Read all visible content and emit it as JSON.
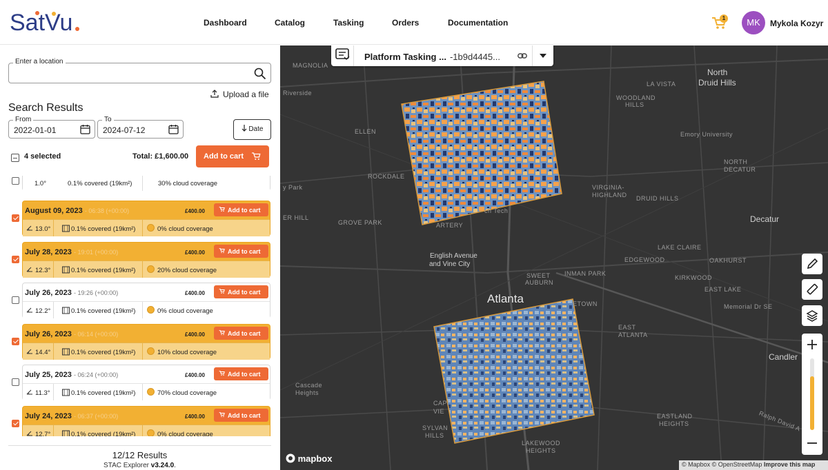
{
  "brand": {
    "name": "SatVu"
  },
  "nav": {
    "items": [
      "Dashboard",
      "Catalog",
      "Tasking",
      "Orders",
      "Documentation"
    ]
  },
  "cart": {
    "count": "1"
  },
  "user": {
    "initials": "MK",
    "name": "Mykola Kozyr"
  },
  "search": {
    "label": "Enter a location",
    "value": "",
    "upload_label": "Upload a file"
  },
  "results": {
    "title": "Search Results",
    "from_label": "From",
    "from_value": "2022-01-01",
    "to_label": "To",
    "to_value": "2024-07-12",
    "sort_label": "Date",
    "selected_text": "4 selected",
    "total_text": "Total: £1,600.00",
    "add_all_label": "Add to cart",
    "count_text": "12/12 Results",
    "explorer_prefix": "STAC Explorer ",
    "explorer_version": "v3.24.0",
    "explorer_suffix": ".",
    "partial_row": {
      "angle": "1.0°",
      "covered": "0.1% covered (19km²)",
      "cloud": "30% cloud coverage"
    },
    "items": [
      {
        "date": "August 09, 2023",
        "time": "- 06:38 (+00:00)",
        "price": "£400.00",
        "add": "Add to cart",
        "angle": "13.0°",
        "covered": "0.1% covered (19km²)",
        "cloud": "0% cloud coverage",
        "selected": true
      },
      {
        "date": "July 28, 2023",
        "time": "- 19:01 (+00:00)",
        "price": "£400.00",
        "add": "Add to cart",
        "angle": "12.3°",
        "covered": "0.1% covered (19km²)",
        "cloud": "20% cloud coverage",
        "selected": true
      },
      {
        "date": "July 26, 2023",
        "time": "- 19:26 (+00:00)",
        "price": "£400.00",
        "add": "Add to cart",
        "angle": "12.2°",
        "covered": "0.1% covered (19km²)",
        "cloud": "0% cloud coverage",
        "selected": false
      },
      {
        "date": "July 26, 2023",
        "time": "- 06:14 (+00:00)",
        "price": "£400.00",
        "add": "Add to cart",
        "angle": "14.4°",
        "covered": "0.1% covered (19km²)",
        "cloud": "10% cloud coverage",
        "selected": true
      },
      {
        "date": "July 25, 2023",
        "time": "- 06:24 (+00:00)",
        "price": "£400.00",
        "add": "Add to cart",
        "angle": "11.3°",
        "covered": "0.1% covered (19km²)",
        "cloud": "70% cloud coverage",
        "selected": false
      },
      {
        "date": "July 24, 2023",
        "time": "- 06:37 (+00:00)",
        "price": "£400.00",
        "add": "Add to cart",
        "angle": "12.7°",
        "covered": "0.1% covered (19km²)",
        "cloud": "0% cloud coverage",
        "selected": true
      }
    ]
  },
  "map": {
    "tab_title": "Platform Tasking ...",
    "tab_id": "-1b9d4445...",
    "logo": "mapbox",
    "attribution": "© Mapbox © OpenStreetMap ",
    "improve": "Improve this map",
    "zoom_level": 0.75,
    "labels": [
      "MAGNOLIA",
      "North",
      "Druid Hills",
      "LA VISTA",
      "Riverside",
      "WOODLAND",
      "HILLS",
      "ELLEN",
      "Emory University",
      "NORTH",
      "DECATUR",
      "ROCKDALE",
      "y Park",
      "VIRGINIA-",
      "HIGHLAND",
      "DRUID HILLS",
      "ER HILL",
      "GROVE PARK",
      "ARTERY",
      "ch Tech",
      "Decatur",
      "LAKE CLAIRE",
      "English Avenue",
      "and Vine City",
      "EDGEWOOD",
      "OAKHURST",
      "SWEET",
      "AUBURN",
      "INMAN PARK",
      "KIRKWOOD",
      "Atlanta",
      "ETOWN",
      "EAST LAKE",
      "Memorial Dr SE",
      "EAST",
      "ATLANTA",
      "Candler",
      "Cascade",
      "Heights",
      "CAPI",
      "VIE",
      "EASTLAND",
      "HEIGHTS",
      "SYLVAN",
      "HILLS",
      "LAKEWOOD",
      "HEIGHTS",
      "Ralph David A"
    ]
  },
  "colors": {
    "accent": "#ee6a35",
    "selected_row": "#f2b033",
    "map_bg": "#343434",
    "avatar": "#9c4fc0"
  }
}
